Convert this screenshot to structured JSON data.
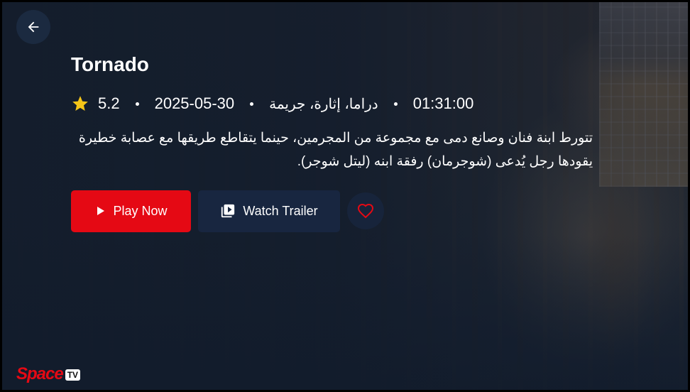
{
  "movie": {
    "title": "Tornado",
    "rating": "5.2",
    "release_date": "2025-05-30",
    "genres": "دراما، إثارة، جريمة",
    "duration": "01:31:00",
    "description_lines": [
      "تتورط ابنة فنان وصانع دمى مع مجموعة من المجرمين، حينما يتقاطع طريقها مع عصابة خطيرة",
      "يقودها رجل يُدعى (شوجرمان) رفقة ابنه (ليتل شوجر)."
    ]
  },
  "actions": {
    "play_label": "Play Now",
    "trailer_label": "Watch Trailer"
  },
  "brand": {
    "logo_text": "Space",
    "logo_badge": "TV"
  },
  "icons": {
    "back": "arrow-left-icon",
    "rating": "star-icon",
    "play": "play-icon",
    "trailer": "video-library-icon",
    "favorite": "heart-outline-icon"
  },
  "colors": {
    "accent": "#e50914",
    "star": "#f5c518",
    "panel": "#182640"
  }
}
